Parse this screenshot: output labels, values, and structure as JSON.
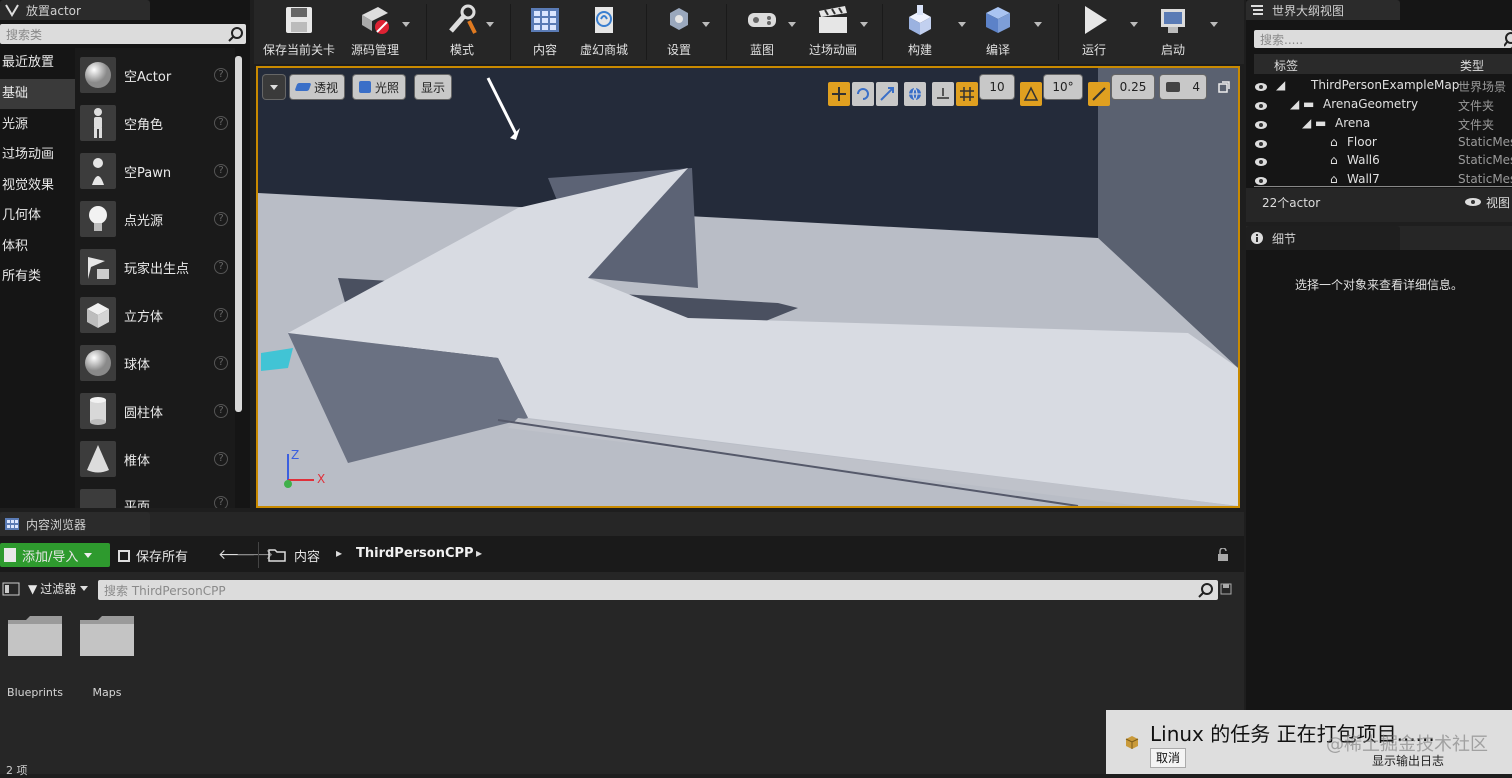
{
  "place_actor": {
    "tab_title": "放置actor",
    "search_placeholder": "搜索类",
    "categories": [
      "最近放置",
      "基础",
      "光源",
      "过场动画",
      "视觉效果",
      "几何体",
      "体积",
      "所有类"
    ],
    "selected_category": "基础",
    "items": [
      {
        "label": "空Actor",
        "icon": "sphere-icon"
      },
      {
        "label": "空角色",
        "icon": "character-icon"
      },
      {
        "label": "空Pawn",
        "icon": "pawn-icon"
      },
      {
        "label": "点光源",
        "icon": "point-light-icon"
      },
      {
        "label": "玩家出生点",
        "icon": "player-start-icon"
      },
      {
        "label": "立方体",
        "icon": "cube-icon"
      },
      {
        "label": "球体",
        "icon": "sphere-icon"
      },
      {
        "label": "圆柱体",
        "icon": "cylinder-icon"
      },
      {
        "label": "椎体",
        "icon": "cone-icon"
      },
      {
        "label": "平面",
        "icon": "plane-icon"
      }
    ],
    "help_glyph": "?"
  },
  "toolbar": {
    "buttons": [
      {
        "label": "保存当前关卡",
        "icon": "save-icon"
      },
      {
        "label": "源码管理",
        "icon": "source-control-icon"
      },
      {
        "label": "模式",
        "icon": "modes-icon"
      },
      {
        "label": "内容",
        "icon": "content-icon"
      },
      {
        "label": "虚幻商城",
        "icon": "marketplace-icon"
      },
      {
        "label": "设置",
        "icon": "settings-icon"
      },
      {
        "label": "蓝图",
        "icon": "blueprint-icon"
      },
      {
        "label": "过场动画",
        "icon": "cinematics-icon"
      },
      {
        "label": "构建",
        "icon": "build-icon"
      },
      {
        "label": "编译",
        "icon": "compile-icon"
      },
      {
        "label": "运行",
        "icon": "play-icon"
      },
      {
        "label": "启动",
        "icon": "launch-icon"
      }
    ]
  },
  "viewport": {
    "perspective_label": "透视",
    "lighting_label": "光照",
    "show_label": "显示",
    "grid_snap": "10",
    "rotation_snap": "10°",
    "scale_snap": "0.25",
    "camera_speed": "4",
    "axis_z": "Z",
    "axis_x": "X"
  },
  "outliner": {
    "tab_title": "世界大纲视图",
    "search_placeholder": "搜索.....",
    "col_label": "标签",
    "col_type": "类型",
    "rows": [
      {
        "label": "ThirdPersonExampleMap",
        "type": "世界场景"
      },
      {
        "label": "ArenaGeometry",
        "type": "文件夹"
      },
      {
        "label": "Arena",
        "type": "文件夹"
      },
      {
        "label": "Floor",
        "type": "StaticMes"
      },
      {
        "label": "Wall6",
        "type": "StaticMes"
      },
      {
        "label": "Wall7",
        "type": "StaticMes"
      }
    ],
    "actor_count": "22个actor",
    "view_options": "视图"
  },
  "details": {
    "tab_title": "细节",
    "empty_message": "选择一个对象来查看详细信息。"
  },
  "content_browser": {
    "tab_title": "内容浏览器",
    "add_import": "添加/导入",
    "save_all": "保存所有",
    "path_root": "内容",
    "path_current": "ThirdPersonCPP",
    "filters": "过滤器",
    "search_placeholder": "搜索 ThirdPersonCPP",
    "folders": [
      "Blueprints",
      "Maps"
    ],
    "item_count": "2 项"
  },
  "toast": {
    "message": "Linux 的任务 正在打包项目......",
    "cancel": "取消",
    "show_log": "显示输出日志",
    "watermark": "@稀土掘金技术社区"
  },
  "colors": {
    "accent": "#c98a00",
    "add_button": "#2e9a2e",
    "panel_bg": "#151515",
    "toolbar_bg": "#262626"
  }
}
